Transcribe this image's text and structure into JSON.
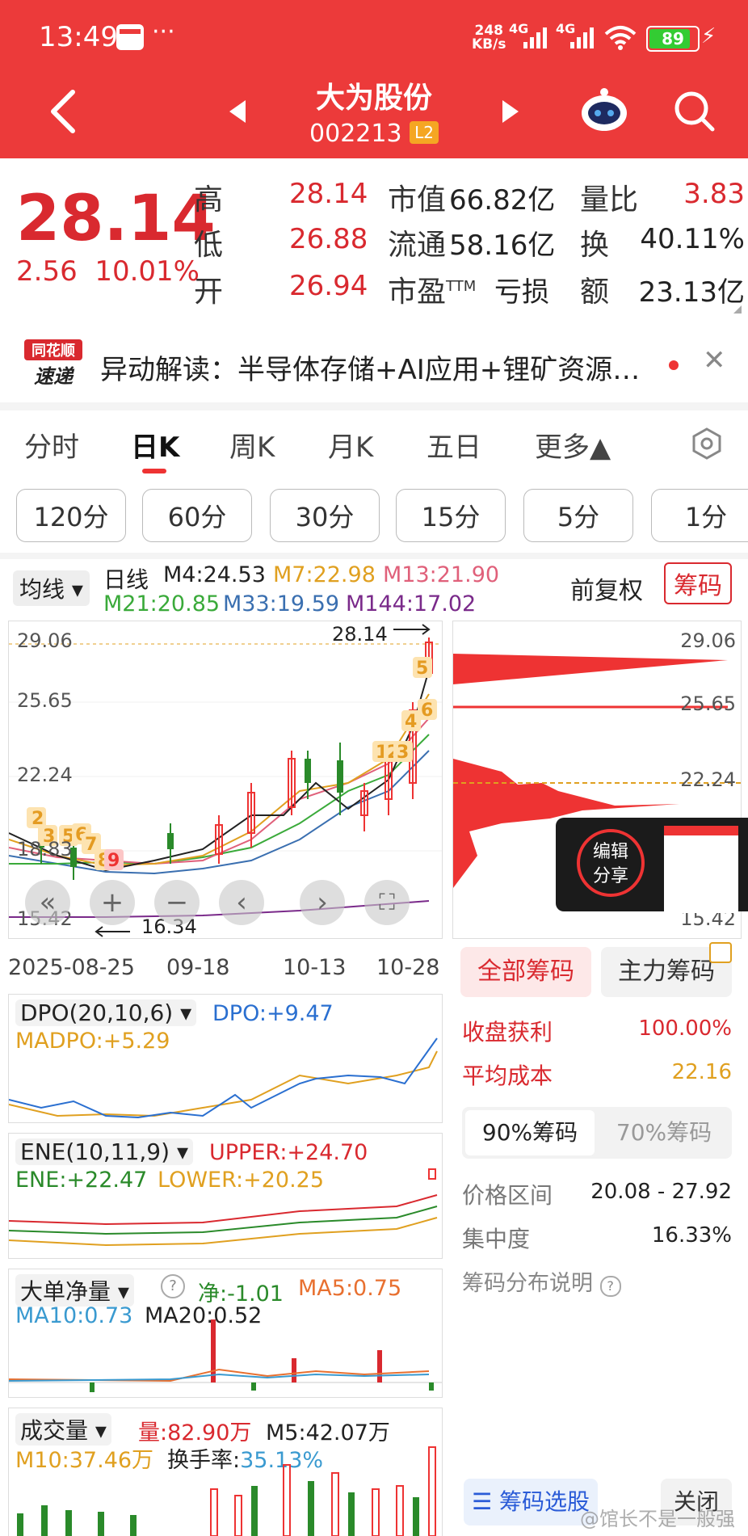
{
  "status": {
    "time": "13:49",
    "dots": "···",
    "net_speed_top": "248",
    "net_speed_bottom": "KB/s",
    "signal1": "4G",
    "signal2": "4G",
    "battery": "89"
  },
  "nav": {
    "title": "大为股份",
    "code": "002213",
    "level": "L2"
  },
  "quote": {
    "price": "28.14",
    "change": "2.56",
    "change_pct": "10.01%",
    "high_label": "高",
    "high": "28.14",
    "low_label": "低",
    "low": "26.88",
    "open_label": "开",
    "open": "26.94",
    "mcap_label": "市值",
    "mcap": "66.82亿",
    "float_label": "流通",
    "float": "58.16亿",
    "pe_label": "市盈",
    "pe_sup": "TTM",
    "pe": "亏损",
    "vr_label": "量比",
    "vr": "3.83",
    "turn_label": "换",
    "turn": "40.11%",
    "amt_label": "额",
    "amt": "23.13亿"
  },
  "news": {
    "logo_top": "同花顺",
    "logo_bottom": "速递",
    "text": "异动解读：半导体存储+AI应用+锂矿资源…"
  },
  "tabs": [
    "分时",
    "日K",
    "周K",
    "月K",
    "五日",
    "更多▲"
  ],
  "periods": [
    "120分",
    "60分",
    "30分",
    "15分",
    "5分",
    "1分"
  ],
  "ma": {
    "selector": "均线",
    "daily": "日线",
    "m4": "M4:24.53",
    "m7": "M7:22.98",
    "m13": "M13:21.90",
    "m21": "M21:20.85",
    "m33": "M33:19.59",
    "m144": "M144:17.02",
    "fuquan": "前复权",
    "chouma": "筹码",
    "colors": {
      "m4": "#222222",
      "m7": "#e0a020",
      "m13": "#e0607a",
      "m21": "#3aaa3a",
      "m33": "#3a6fb0",
      "m144": "#7a2a8a"
    }
  },
  "kline": {
    "y_labels": [
      "29.06",
      "25.65",
      "22.24",
      "18.83",
      "15.42"
    ],
    "x_labels": [
      "2025-08-25",
      "09-18",
      "10-13",
      "10-28"
    ],
    "high_mark": "28.14",
    "low_mark": "16.34",
    "markers": [
      "2",
      "3",
      "5",
      "6",
      "7",
      "8",
      "9",
      "1",
      "2",
      "3",
      "4",
      "5",
      "6"
    ]
  },
  "chip": {
    "y_labels": [
      "29.06",
      "25.65",
      "22.24",
      "15.42"
    ],
    "popup": {
      "l1": "编辑",
      "l2": "分享"
    },
    "tab_all": "全部筹码",
    "tab_main": "主力筹码",
    "profit_label": "收盘获利",
    "profit": "100.00%",
    "avg_label": "平均成本",
    "avg": "22.16",
    "btn90": "90%筹码",
    "btn70": "70%筹码",
    "range_label": "价格区间",
    "range": "20.08 - 27.92",
    "conc_label": "集中度",
    "conc": "16.33%",
    "explain": "筹码分布说明",
    "select": "筹码选股",
    "close": "关闭"
  },
  "ind1": {
    "name": "DPO(20,10,6)",
    "v1": "DPO:+9.47",
    "v2": "MADPO:+5.29"
  },
  "ind2": {
    "name": "ENE(10,11,9)",
    "v1": "UPPER:+24.70",
    "v2": "ENE:+22.47",
    "v3": "LOWER:+20.25"
  },
  "ind3": {
    "name": "大单净量",
    "v1": "净:-1.01",
    "v2": "MA5:0.75",
    "v3": "MA10:0.73",
    "v4": "MA20:0.52"
  },
  "ind4": {
    "name": "成交量",
    "v1": "量:82.90万",
    "v2": "M5:42.07万",
    "v3": "M10:37.46万",
    "v4_label": "换手率:",
    "v4": "35.13%"
  },
  "watermark": "@馆长不是一般强"
}
